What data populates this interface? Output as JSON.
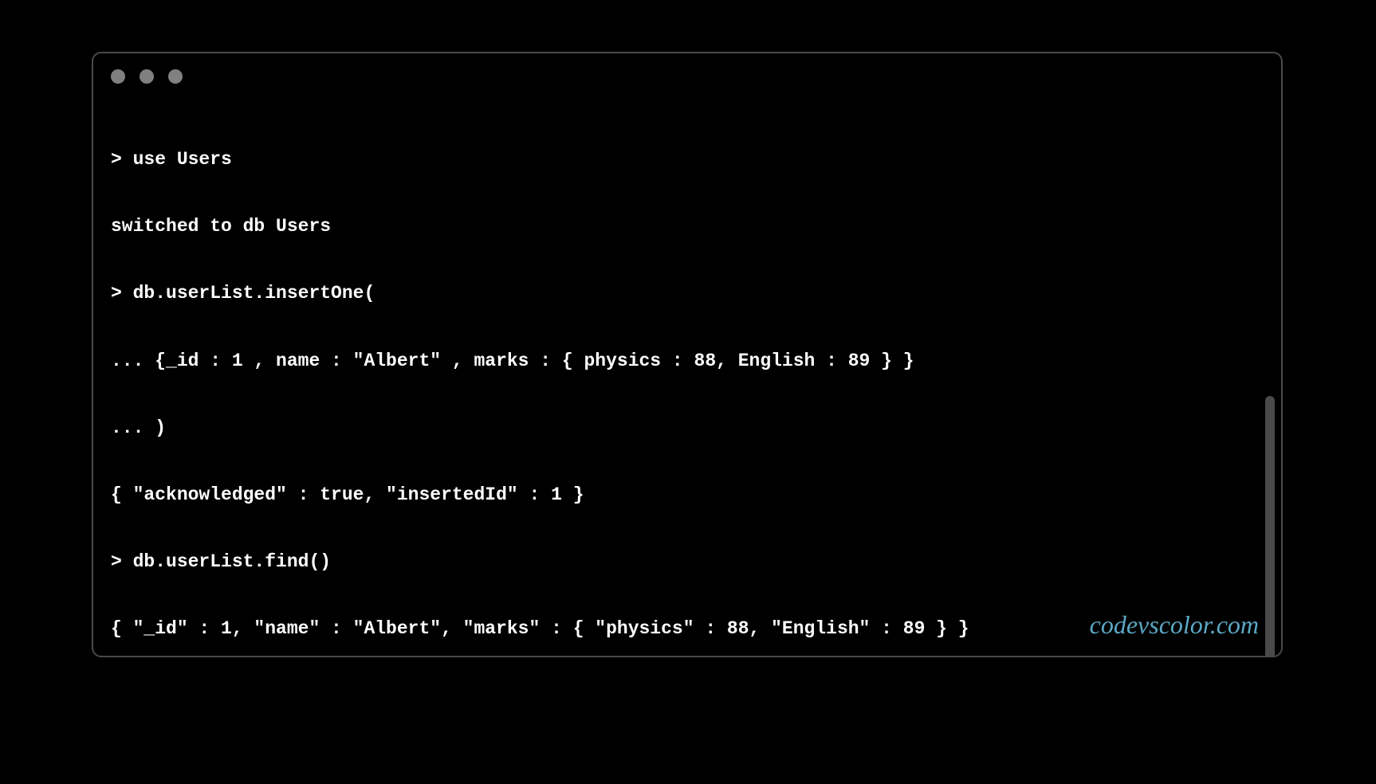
{
  "terminal": {
    "lines": [
      "> use Users",
      "switched to db Users",
      "> db.userList.insertOne(",
      "... {_id : 1 , name : \"Albert\" , marks : { physics : 88, English : 89 } }",
      "... )",
      "{ \"acknowledged\" : true, \"insertedId\" : 1 }",
      "> db.userList.find()",
      "{ \"_id\" : 1, \"name\" : \"Albert\", \"marks\" : { \"physics\" : 88, \"English\" : 89 } }",
      "> "
    ]
  },
  "watermark": "codevscolor.com"
}
